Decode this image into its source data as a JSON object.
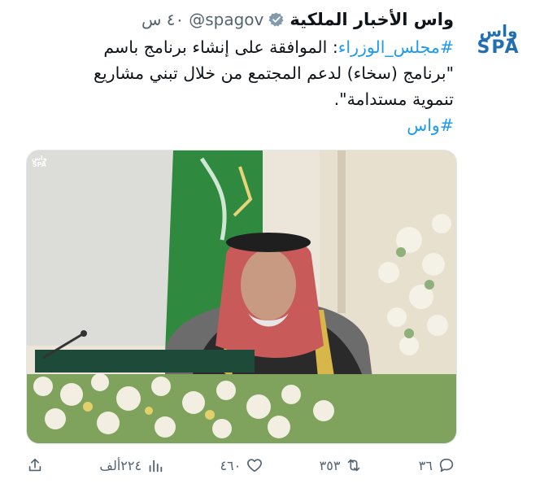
{
  "account": {
    "display_name": "واس الأخبار الملكية",
    "handle": "@spagov",
    "time": "٤٠ س",
    "logo_arabic": "واس",
    "logo_latin": "SPA"
  },
  "tweet": {
    "hashtag1": "#مجلس_الوزراء",
    "line1_rest": ": الموافقة على إنشاء برنامج باسم",
    "line2": "\"برنامج (سخاء) لدعم المجتمع من خلال تبني مشاريع",
    "line3": "تنموية مستدامة\".",
    "hashtag2": "#واس"
  },
  "media": {
    "watermark_ar": "واس",
    "watermark_en": "SPA"
  },
  "actions": {
    "replies": "٣٦",
    "retweets": "٣٥٣",
    "likes": "٤٦٠",
    "views": "٢٢٤ألف"
  },
  "colors": {
    "link": "#1d9bf0",
    "secondary_text": "#536471",
    "verified_badge": "#829aab",
    "brand": "#1f6fb2"
  }
}
